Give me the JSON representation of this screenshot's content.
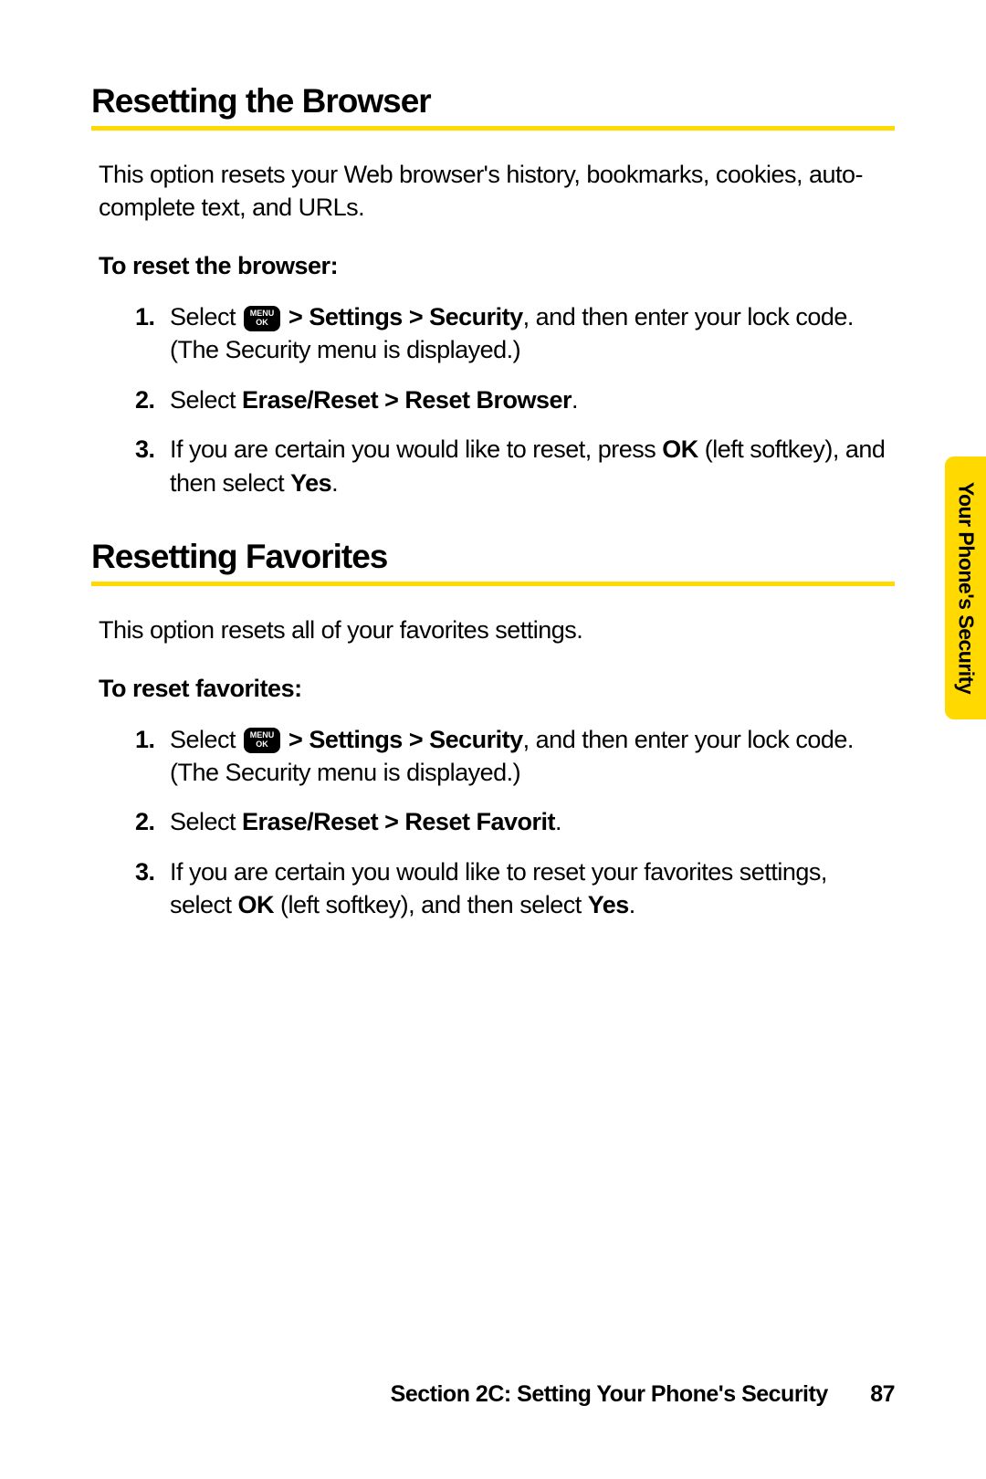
{
  "section1": {
    "heading": "Resetting the Browser",
    "intro": "This option resets your Web browser's history, bookmarks, cookies, auto-complete text, and URLs.",
    "subhead": "To reset the browser:",
    "steps": [
      {
        "num": "1.",
        "pre": "Select ",
        "menuKey": "MENU\nOK",
        "bold1": " > Settings > Security",
        "post1": ", and then enter your lock code. (The Security menu is displayed.)"
      },
      {
        "num": "2.",
        "pre": "Select ",
        "bold1": "Erase/Reset > Reset Browser",
        "post1": "."
      },
      {
        "num": "3.",
        "pre": "If you are certain you would like to reset, press ",
        "bold1": "OK",
        "post1": " (left softkey), and then select ",
        "bold2": "Yes",
        "post2": "."
      }
    ]
  },
  "section2": {
    "heading": "Resetting Favorites",
    "intro": "This option resets all of your favorites settings.",
    "subhead": "To reset favorites:",
    "steps": [
      {
        "num": "1.",
        "pre": "Select ",
        "menuKey": "MENU\nOK",
        "bold1": " > Settings > Security",
        "post1": ", and then enter your lock code. (The Security menu is displayed.)"
      },
      {
        "num": "2.",
        "pre": "Select ",
        "bold1": "Erase/Reset > Reset Favorit",
        "post1": "."
      },
      {
        "num": "3.",
        "pre": " If you are certain you would like to reset your favorites settings, select ",
        "bold1": "OK",
        "post1": " (left softkey), and then select ",
        "bold2": "Yes",
        "post2": "."
      }
    ]
  },
  "sideTab": "Your Phone's Security",
  "footer": {
    "text": "Section 2C: Setting Your Phone's Security",
    "page": "87"
  }
}
